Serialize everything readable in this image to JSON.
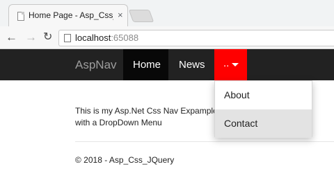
{
  "browser": {
    "tab_title": "Home Page - Asp_Css_JQuery",
    "close_glyph": "×",
    "url_host": "localhost",
    "url_port": ":65088"
  },
  "navbar": {
    "brand": "AspNav",
    "items": [
      {
        "label": "Home"
      },
      {
        "label": "News"
      },
      {
        "label": ".."
      }
    ]
  },
  "dropdown": {
    "items": [
      {
        "label": "About"
      },
      {
        "label": "Contact"
      }
    ]
  },
  "content": {
    "line1": "This is my Asp.Net Css Nav Expample",
    "line2": "with a DropDown Menu"
  },
  "footer": {
    "text": "© 2018 - Asp_Css_JQuery"
  },
  "colors": {
    "navbar_bg": "#222222",
    "active_item_bg": "#080808",
    "dropdown_toggle_bg": "#ff0000",
    "hover_item_bg": "#e3e3e3"
  }
}
